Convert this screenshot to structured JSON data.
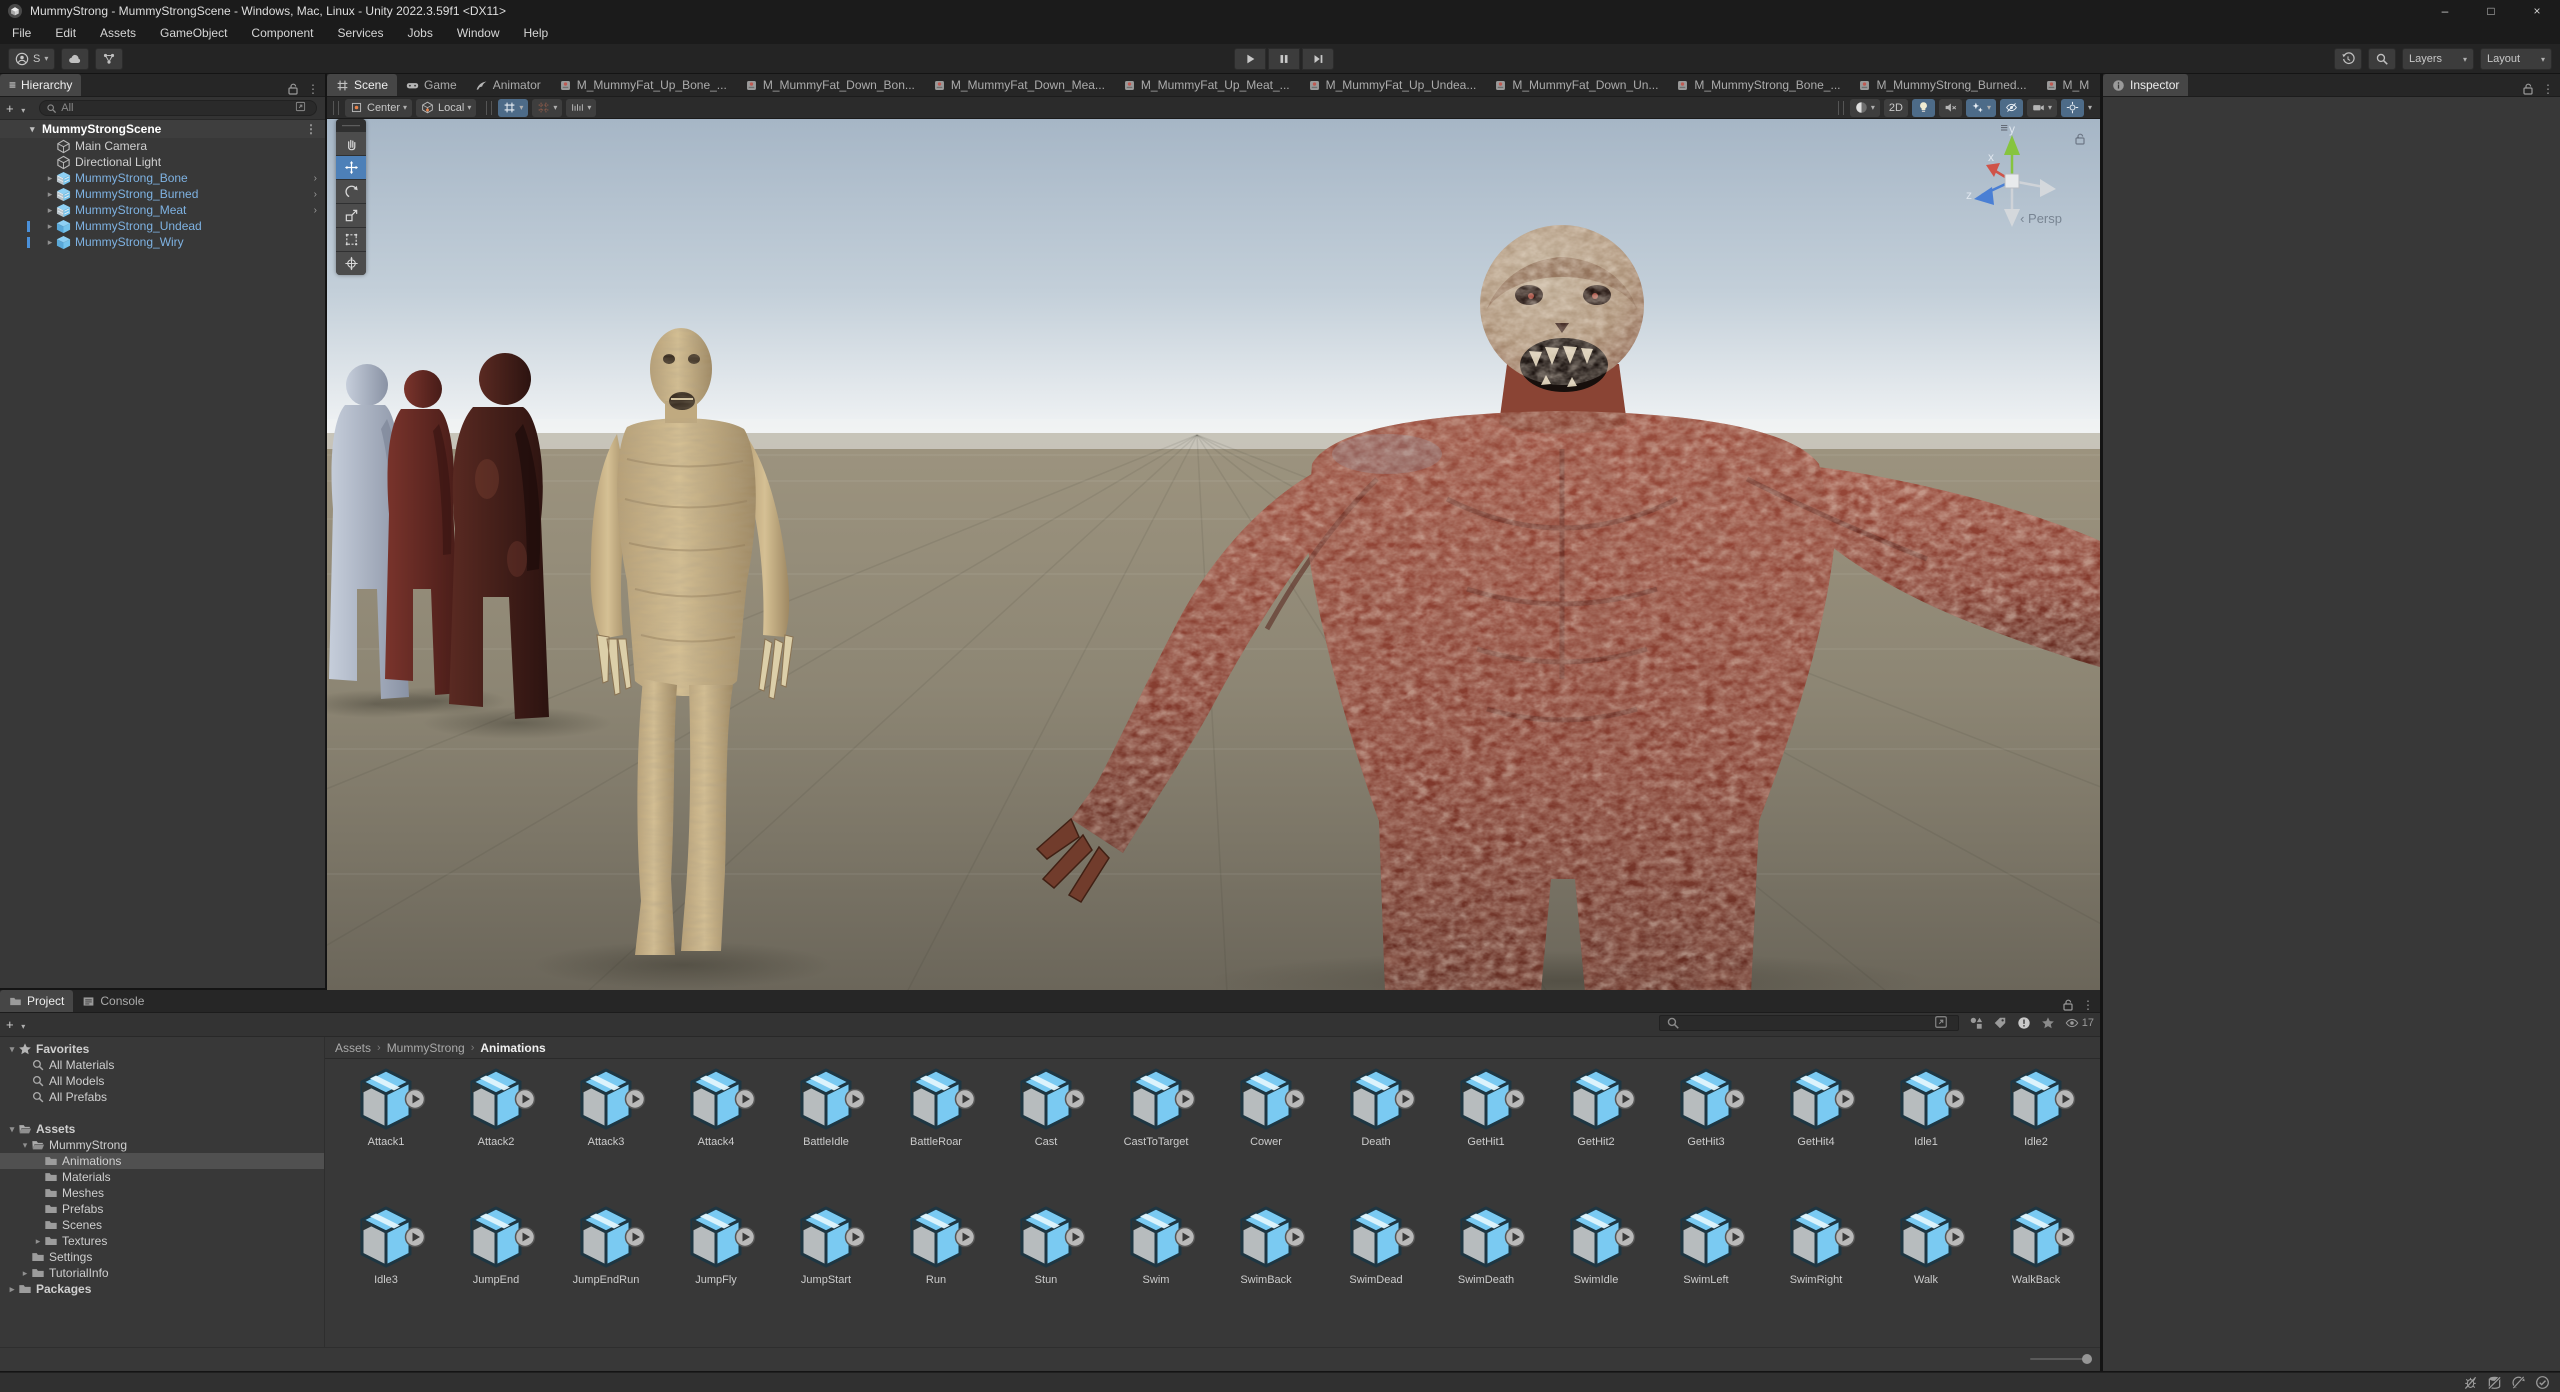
{
  "window": {
    "title": "MummyStrong - MummyStrongScene - Windows, Mac, Linux - Unity 2022.3.59f1 <DX11>",
    "menus": [
      "File",
      "Edit",
      "Assets",
      "GameObject",
      "Component",
      "Services",
      "Jobs",
      "Window",
      "Help"
    ],
    "controls": {
      "minimize": "–",
      "maximize": "□",
      "close": "×"
    }
  },
  "toolbar": {
    "account_label": "S",
    "layers_label": "Layers",
    "layout_label": "Layout"
  },
  "hierarchy": {
    "tab": "Hierarchy",
    "search_placeholder": "All",
    "scene_name": "MummyStrongScene",
    "items": [
      {
        "label": "Main Camera",
        "icon": "gameobject",
        "style": "plain"
      },
      {
        "label": "Directional Light",
        "icon": "gameobject",
        "style": "plain"
      },
      {
        "label": "MummyStrong_Bone",
        "icon": "prefab-model",
        "style": "prefab",
        "expander": true,
        "nav": true
      },
      {
        "label": "MummyStrong_Burned",
        "icon": "prefab-model",
        "style": "prefab",
        "expander": true,
        "nav": true
      },
      {
        "label": "MummyStrong_Meat",
        "icon": "prefab-model",
        "style": "prefab",
        "expander": true,
        "nav": true
      },
      {
        "label": "MummyStrong_Undead",
        "icon": "prefab",
        "style": "prefab",
        "expander": true,
        "nav": false,
        "mark": true
      },
      {
        "label": "MummyStrong_Wiry",
        "icon": "prefab",
        "style": "prefab",
        "expander": true,
        "nav": false,
        "mark": true
      }
    ]
  },
  "scene_view": {
    "tabs": [
      {
        "label": "Scene",
        "icon": "scene",
        "active": true
      },
      {
        "label": "Game",
        "icon": "game",
        "active": false
      },
      {
        "label": "Animator",
        "icon": "animator",
        "active": false
      },
      {
        "label": "M_MummyFat_Up_Bone_...",
        "icon": "clip",
        "active": false
      },
      {
        "label": "M_MummyFat_Down_Bon...",
        "icon": "clip",
        "active": false
      },
      {
        "label": "M_MummyFat_Down_Mea...",
        "icon": "clip",
        "active": false
      },
      {
        "label": "M_MummyFat_Up_Meat_...",
        "icon": "clip",
        "active": false
      },
      {
        "label": "M_MummyFat_Up_Undea...",
        "icon": "clip",
        "active": false
      },
      {
        "label": "M_MummyFat_Down_Un...",
        "icon": "clip",
        "active": false
      },
      {
        "label": "M_MummyStrong_Bone_...",
        "icon": "clip",
        "active": false
      },
      {
        "label": "M_MummyStrong_Burned...",
        "icon": "clip",
        "active": false
      },
      {
        "label": "M_M",
        "icon": "clip",
        "active": false
      }
    ],
    "toolbar": {
      "pivot": "Center",
      "orientation": "Local",
      "mode_2d": "2D"
    },
    "overlay": {
      "projection": "Persp",
      "axis_x": "x",
      "axis_y": "y",
      "axis_z": "z"
    }
  },
  "inspector": {
    "tab": "Inspector"
  },
  "project": {
    "tabs": [
      {
        "label": "Project",
        "icon": "folder",
        "active": true
      },
      {
        "label": "Console",
        "icon": "console",
        "active": false
      }
    ],
    "favorites": [
      {
        "label": "Favorites",
        "icon": "star",
        "indent": 0,
        "expander": "open",
        "bold": true
      },
      {
        "label": "All Materials",
        "icon": "search",
        "indent": 1
      },
      {
        "label": "All Models",
        "icon": "search",
        "indent": 1
      },
      {
        "label": "All Prefabs",
        "icon": "search",
        "indent": 1
      }
    ],
    "tree": [
      {
        "label": "Assets",
        "icon": "folder-open",
        "indent": 0,
        "expander": "open",
        "bold": true
      },
      {
        "label": "MummyStrong",
        "icon": "folder-open",
        "indent": 1,
        "expander": "open"
      },
      {
        "label": "Animations",
        "icon": "folder",
        "indent": 2,
        "selected": true
      },
      {
        "label": "Materials",
        "icon": "folder",
        "indent": 2
      },
      {
        "label": "Meshes",
        "icon": "folder",
        "indent": 2
      },
      {
        "label": "Prefabs",
        "icon": "folder",
        "indent": 2
      },
      {
        "label": "Scenes",
        "icon": "folder",
        "indent": 2
      },
      {
        "label": "Textures",
        "icon": "folder",
        "indent": 2,
        "expander": "closed"
      },
      {
        "label": "Settings",
        "icon": "folder",
        "indent": 1
      },
      {
        "label": "TutorialInfo",
        "icon": "folder",
        "indent": 1,
        "expander": "closed"
      },
      {
        "label": "Packages",
        "icon": "folder",
        "indent": 0,
        "expander": "closed",
        "bold": true
      }
    ],
    "breadcrumb": [
      "Assets",
      "MummyStrong",
      "Animations"
    ],
    "assets": [
      "Attack1",
      "Attack2",
      "Attack3",
      "Attack4",
      "BattleIdle",
      "BattleRoar",
      "Cast",
      "CastToTarget",
      "Cower",
      "Death",
      "GetHit1",
      "GetHit2",
      "GetHit3",
      "GetHit4",
      "Idle1",
      "Idle2",
      "Idle3",
      "JumpEnd",
      "JumpEndRun",
      "JumpFly",
      "JumpStart",
      "Run",
      "Stun",
      "Swim",
      "SwimBack",
      "SwimDead",
      "SwimDeath",
      "SwimIdle",
      "SwimLeft",
      "SwimRight",
      "Walk",
      "WalkBack"
    ],
    "hidden_count": "17"
  },
  "status_bar": {
    "icons": [
      "debugger-disabled",
      "cache-server-disconnected",
      "refresh-disabled",
      "progress-ok"
    ]
  },
  "colors": {
    "panel": "#383838",
    "chrome": "#1b1b1b",
    "accent_toggle_blue": "#4d6b88",
    "prefab_text_blue": "#7eb2e2",
    "asset_icon_blue": "#76c8f0",
    "selection_gray": "#505050"
  }
}
